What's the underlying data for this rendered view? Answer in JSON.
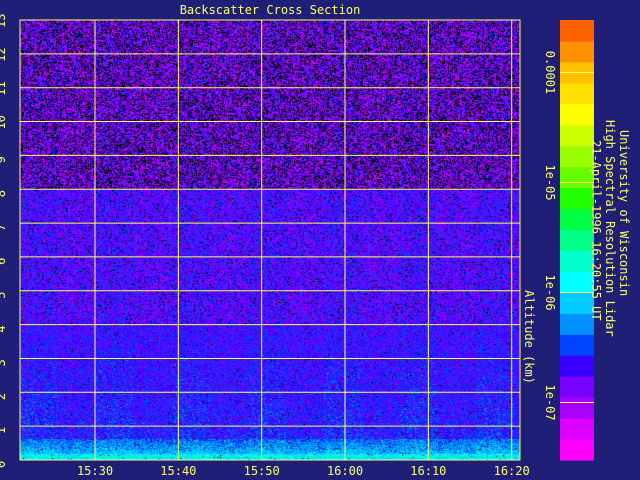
{
  "chart_data": {
    "type": "heatmap",
    "title": "Backscatter Cross Section",
    "xlabel": "",
    "ylabel": "Altitude (km)",
    "x_ticks": [
      "15:30",
      "15:40",
      "15:50",
      "16:00",
      "16:10",
      "16:20"
    ],
    "x_tick_minutes": [
      930,
      940,
      950,
      960,
      970,
      980
    ],
    "xlim_minutes": [
      921,
      981
    ],
    "y_ticks": [
      "0",
      "1",
      "2",
      "3",
      "4",
      "5",
      "6",
      "7",
      "8",
      "9",
      "10",
      "11",
      "12",
      "13"
    ],
    "y_tick_values": [
      0,
      1,
      2,
      3,
      4,
      5,
      6,
      7,
      8,
      9,
      10,
      11,
      12,
      13
    ],
    "ylim": [
      0,
      13
    ],
    "grid": true,
    "colorbar": {
      "scale": "log",
      "range": [
        3e-08,
        0.0003
      ],
      "tick_labels": [
        "1e-07",
        "1e-06",
        "1e-05",
        "0.0001"
      ],
      "tick_values": [
        1e-07,
        1e-06,
        1e-05,
        0.0001
      ],
      "colors": [
        "#ff00ff",
        "#dd00ff",
        "#aa00ff",
        "#7a00ff",
        "#3a00ff",
        "#0044ff",
        "#0090ff",
        "#00ccff",
        "#00ffff",
        "#00ffcc",
        "#00ff88",
        "#00ff44",
        "#22ff00",
        "#66ff00",
        "#99ff00",
        "#ccff00",
        "#ffff00",
        "#ffe000",
        "#ffc000",
        "#ff9000",
        "#ff6000"
      ]
    },
    "profile_description": "log10 backscatter: ~1e-6 near surface (0-0.6 km), ~3e-7 from 0.6-4 km, ~2e-7 from 4-8 km, noisy 1e-7 with black gaps above 8 km"
  },
  "annotation": {
    "line1": "University of Wisconsin",
    "line2": "High Spectral Resolution Lidar",
    "line3": "21-April-1996 16:20:55 UT"
  },
  "colors": {
    "background": "#1f1f78",
    "grid": "#ffff66",
    "text": "#ffff66"
  }
}
